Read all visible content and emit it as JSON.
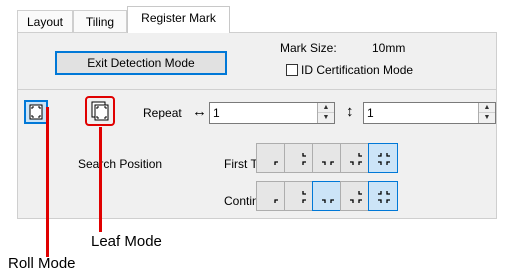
{
  "tabs": [
    {
      "label": "Layout",
      "active": false
    },
    {
      "label": "Tiling",
      "active": false
    },
    {
      "label": "Register Mark",
      "active": true
    }
  ],
  "exit_button": "Exit Detection Mode",
  "mark_size": {
    "label": "Mark Size:",
    "value": "10mm"
  },
  "id_certification": {
    "label": "ID Certification Mode",
    "checked": false
  },
  "mode_icons": {
    "roll": "roll-mode-icon",
    "leaf": "leaf-mode-icon",
    "selected": "roll"
  },
  "repeat": {
    "label": "Repeat",
    "horizontal_icon": "↔",
    "horizontal_value": "1",
    "vertical_icon": "↕",
    "vertical_value": "1"
  },
  "search_position": {
    "label": "Search Position",
    "rows": [
      {
        "label": "First Time",
        "selected_index": 4
      },
      {
        "label": "Continue",
        "selected_index": 4
      }
    ]
  },
  "annotations": {
    "leaf": "Leaf Mode",
    "roll": "Roll Mode"
  },
  "colors": {
    "accent": "#0078d7",
    "annotation_red": "#e00000"
  }
}
